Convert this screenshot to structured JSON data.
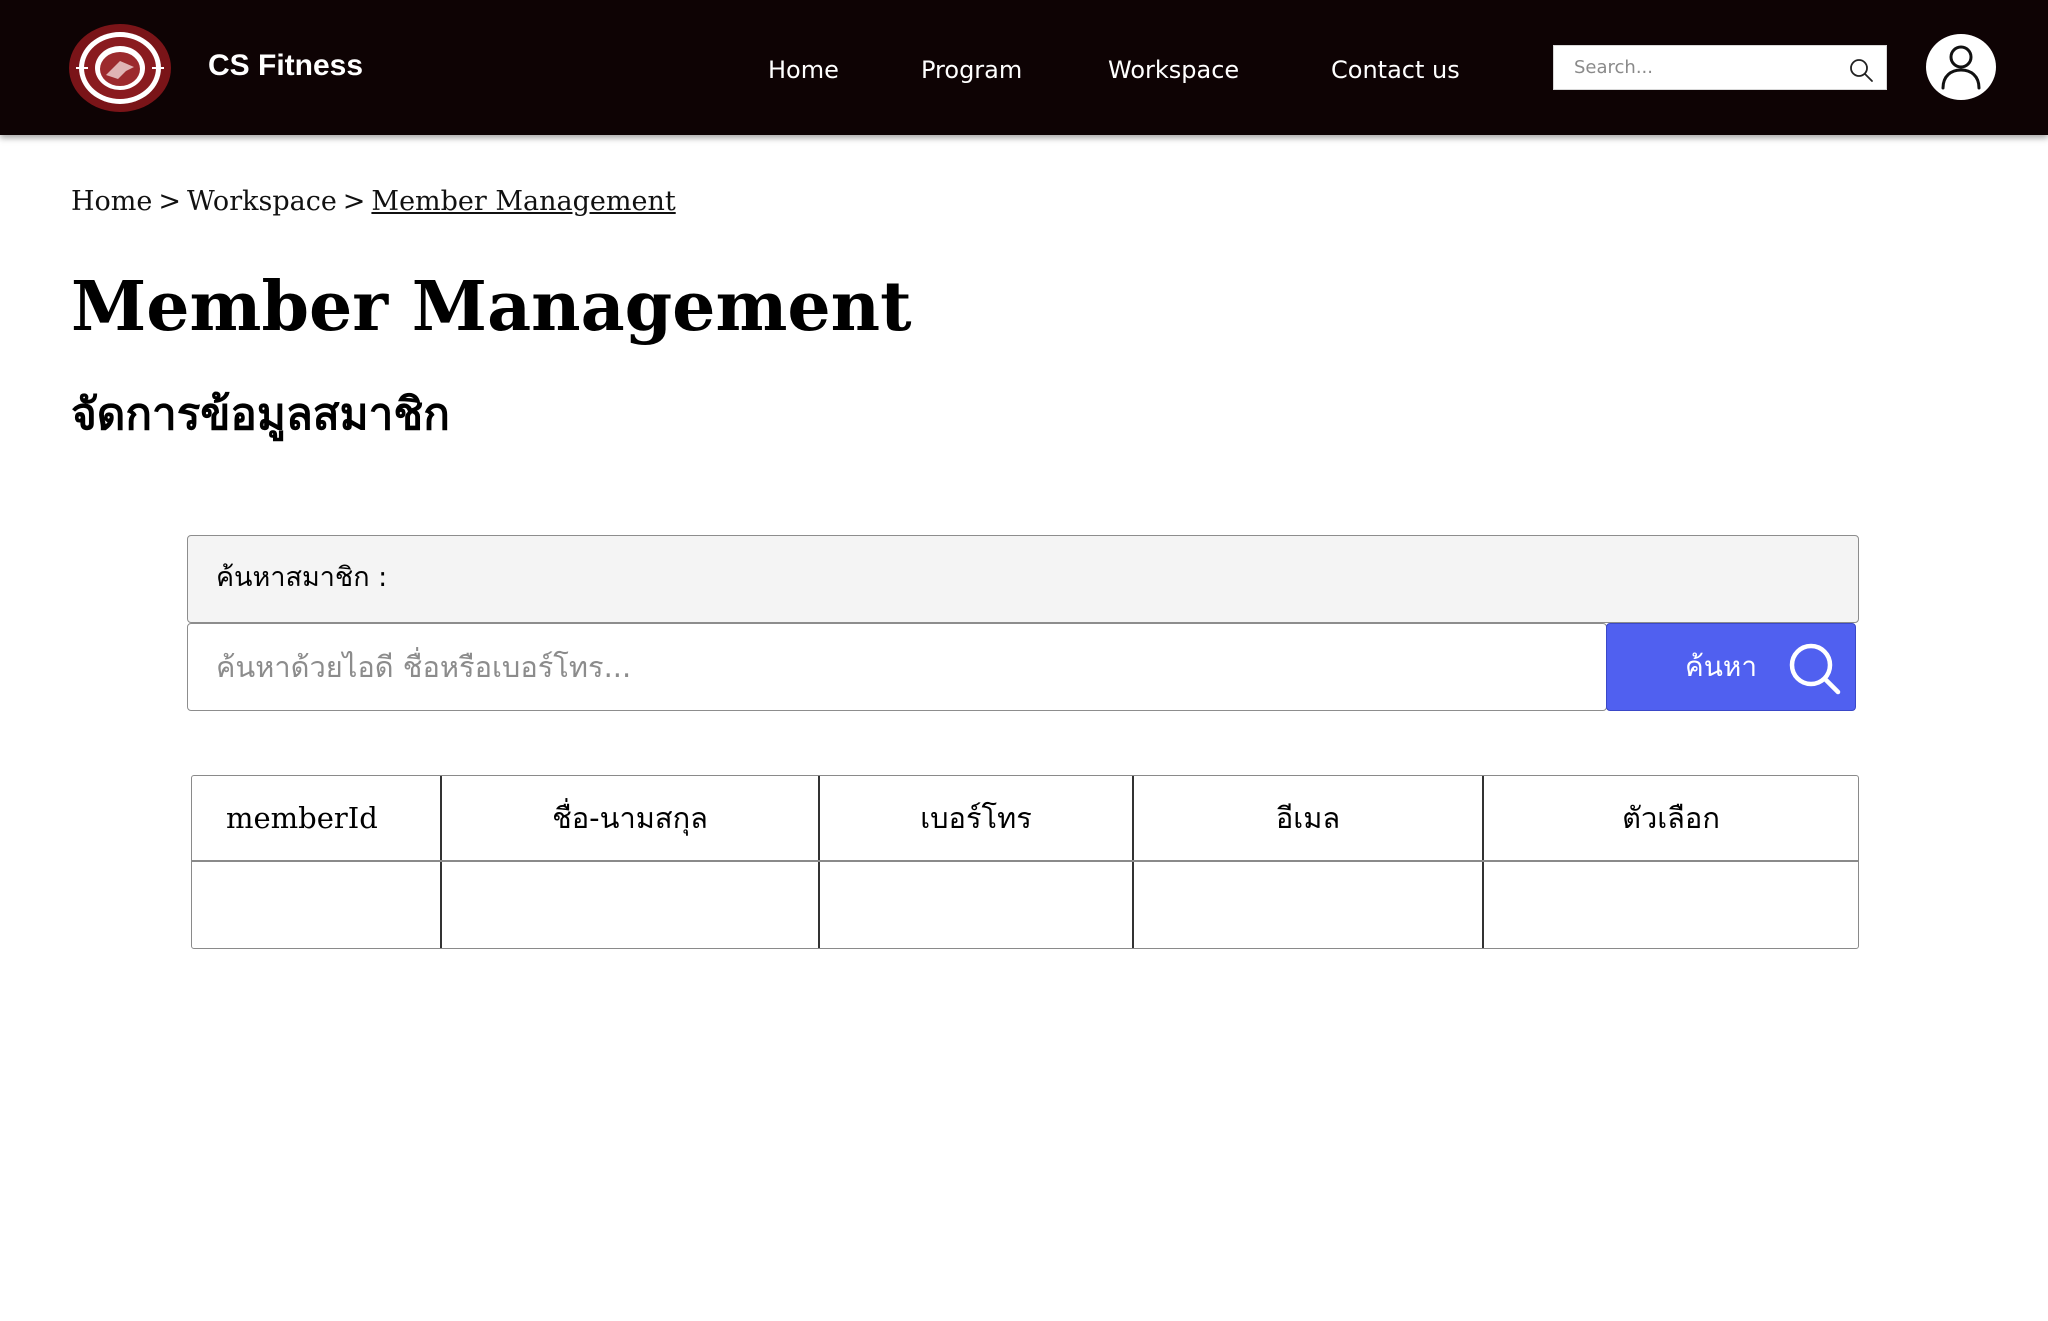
{
  "navbar": {
    "brand": "CS Fitness",
    "logo_icon": "cs-fitness-logo-icon",
    "links": [
      {
        "label": "Home"
      },
      {
        "label": "Program"
      },
      {
        "label": "Workspace"
      },
      {
        "label": "Contact us"
      }
    ],
    "search": {
      "placeholder": "Search...",
      "icon": "search-icon"
    },
    "avatar_icon": "user-icon"
  },
  "breadcrumb": {
    "items": [
      "Home",
      "Workspace",
      "Member Management"
    ],
    "separator": ">"
  },
  "page": {
    "title": "Member Management",
    "subtitle": "จัดการข้อมูลสมาชิก"
  },
  "member_search": {
    "label": "ค้นหาสมาชิก :",
    "placeholder": "ค้นหาด้วยไอดี ชื่อหรือเบอร์โทร...",
    "button_label": "ค้นหา",
    "button_color": "#5060f0"
  },
  "member_table": {
    "columns": [
      "memberId",
      "ชื่อ-นามสกุล",
      "เบอร์โทร",
      "อีเมล",
      "ตัวเลือก"
    ],
    "rows": [
      [
        "",
        "",
        "",
        "",
        ""
      ]
    ]
  },
  "colors": {
    "navbar_bg": "#0e0304",
    "logo_red": "#7a1418",
    "accent": "#5060f0"
  }
}
